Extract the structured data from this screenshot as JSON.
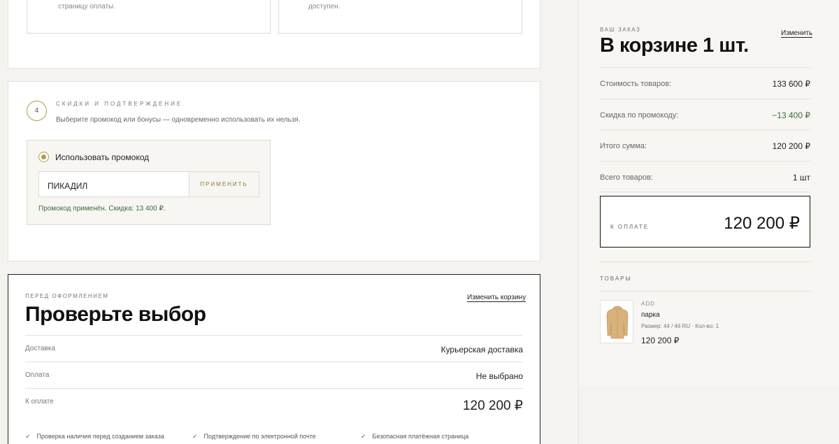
{
  "top_boxes": {
    "left_text": "страницу оплаты.",
    "right_text": "доступен."
  },
  "step4": {
    "number": "4",
    "title": "Скидки и подтверждение",
    "subtitle": "Выберите промокод или бонусы — одновременно использовать их нельзя.",
    "promo_option_label": "Использовать промокод",
    "promo_value": "ПИКАДИЛ",
    "apply_label": "Применить",
    "success_text": "Промокод применён. Скидка: 13 400 ₽."
  },
  "review": {
    "eyebrow": "Перед оформлением",
    "title": "Проверьте выбор",
    "edit_cart_label": "Изменить корзину",
    "rows": [
      {
        "label": "Доставка",
        "value": "Курьерская доставка"
      },
      {
        "label": "Оплата",
        "value": "Не выбрано"
      },
      {
        "label": "К оплате",
        "value": "120 200 ₽"
      }
    ],
    "checks": [
      "Проверка наличия перед созданием заказа",
      "Подтверждение по электронной почте",
      "Безопасная платёжная страница"
    ]
  },
  "summary": {
    "eyebrow": "Ваш заказ",
    "edit_label": "Изменить",
    "title": "В корзине 1 шт.",
    "rows": [
      {
        "label": "Стоимость товаров:",
        "value": "133 600 ₽"
      },
      {
        "label": "Скидка по промокоду:",
        "value": "−13 400 ₽"
      },
      {
        "label": "Итого сумма:",
        "value": "120 200 ₽"
      },
      {
        "label": "Всего товаров:",
        "value": "1 шт"
      }
    ],
    "pay_label": "К оплате",
    "pay_value": "120 200 ₽",
    "goods_label": "Товары",
    "item": {
      "brand": "ADD",
      "name": "парка",
      "meta": "Размер: 44 / 46 RU · Кол-во: 1",
      "price": "120 200 ₽"
    }
  },
  "colors": {
    "accent_gold": "#b69a52",
    "success_green": "#3e6b3e",
    "parka_tan": "#d9b27a"
  }
}
